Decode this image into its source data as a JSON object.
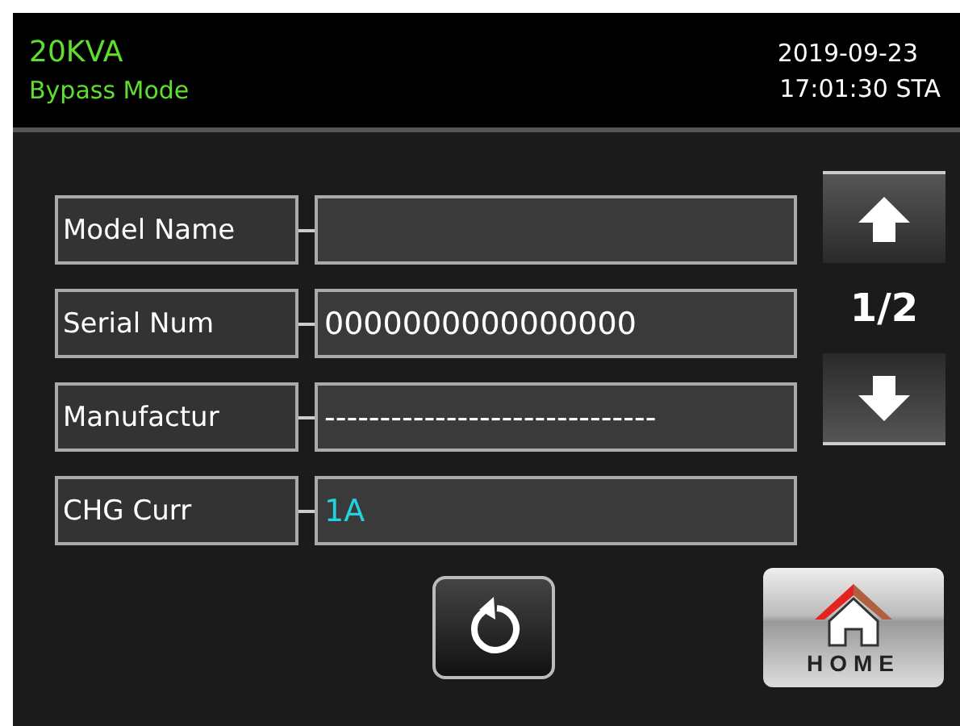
{
  "header": {
    "model": "20KVA",
    "mode": "Bypass Mode",
    "date": "2019-09-23",
    "time": "17:01:30 STA"
  },
  "fields": [
    {
      "label": "Model Name"
    },
    {
      "label": "Serial Num",
      "value": "0000000000000000",
      "highlighted": false
    },
    {
      "label": "Manufactur",
      "value": "------------------------------",
      "highlighted": false
    },
    {
      "label": "CHG Curr",
      "value": "1A",
      "highlighted": true
    }
  ],
  "pager": {
    "page": "1/2"
  },
  "home_button": {
    "label": "HOME"
  }
}
